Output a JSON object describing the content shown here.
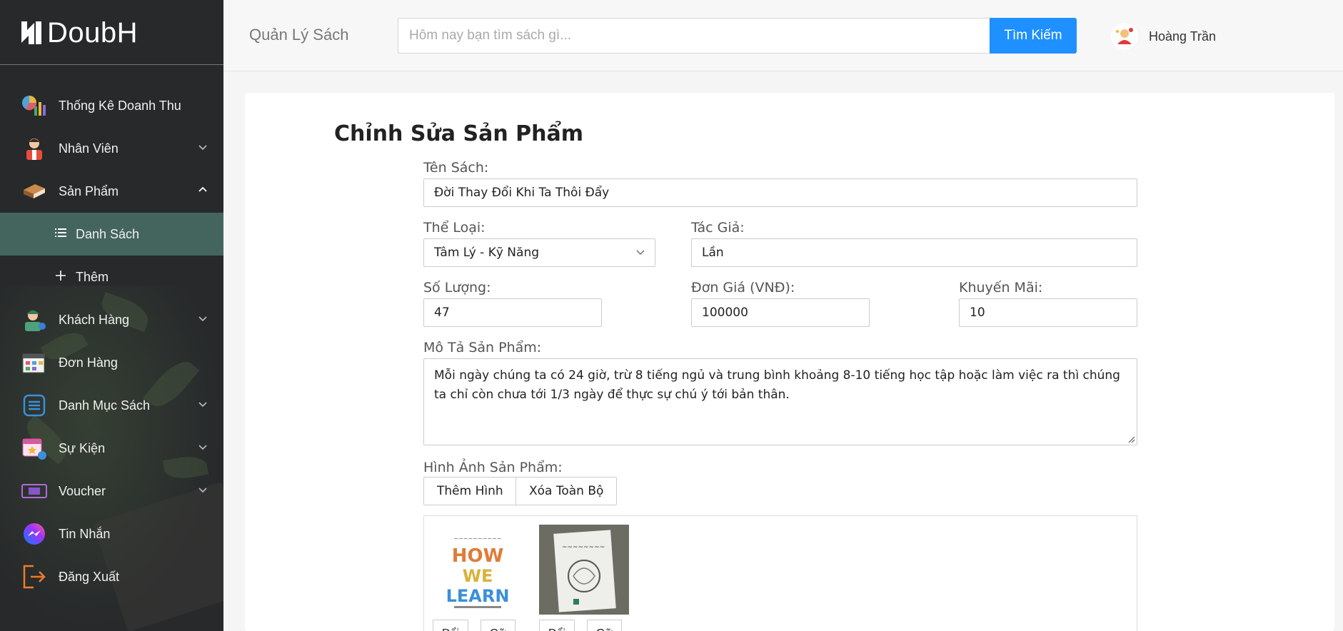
{
  "app": {
    "logo_text": "DoubH",
    "header_title": "Quản Lý Sách"
  },
  "search": {
    "placeholder": "Hôm nay bạn tìm sách gì...",
    "button_label": "Tìm Kiếm"
  },
  "user": {
    "name": "Hoàng Trần"
  },
  "sidebar": {
    "items": [
      {
        "label": "Thống Kê Doanh Thu",
        "icon": "chart-icon"
      },
      {
        "label": "Nhân Viên",
        "icon": "employee-icon"
      },
      {
        "label": "Sản Phẩm",
        "icon": "book-icon"
      },
      {
        "label": "Khách Hàng",
        "icon": "customer-icon"
      },
      {
        "label": "Đơn Hàng",
        "icon": "order-icon"
      },
      {
        "label": "Danh Mục Sách",
        "icon": "catalog-icon"
      },
      {
        "label": "Sự Kiện",
        "icon": "event-icon"
      },
      {
        "label": "Voucher",
        "icon": "voucher-icon"
      },
      {
        "label": "Tin Nhắn",
        "icon": "messenger-icon"
      },
      {
        "label": "Đăng Xuất",
        "icon": "logout-icon"
      }
    ],
    "sub_items": [
      {
        "label": "Danh Sách",
        "icon": "list-icon"
      },
      {
        "label": "Thêm",
        "icon": "plus-icon"
      }
    ]
  },
  "form": {
    "title": "Chỉnh Sửa Sản Phẩm",
    "name_label": "Tên Sách:",
    "name_value": "Đời Thay Đổi Khi Ta Thôi Đẩy",
    "category_label": "Thể Loại:",
    "category_value": "Tâm Lý - Kỹ Năng",
    "author_label": "Tác Giả:",
    "author_value": "Lần",
    "quantity_label": "Số Lượng:",
    "quantity_value": "47",
    "price_label": "Đơn Giá (VNĐ):",
    "price_value": "100000",
    "discount_label": "Khuyến Mãi:",
    "discount_value": "10",
    "description_label": "Mô Tả Sản Phẩm:",
    "description_value": "Mỗi ngày chúng ta có 24 giờ, trừ 8 tiếng ngủ và trung bình khoảng 8-10 tiếng học tập hoặc làm việc ra thì chúng ta chỉ còn chưa tới 1/3 ngày để thực sự chú ý tới bản thân.",
    "images_label": "Hình Ảnh Sản Phẩm:",
    "add_image_label": "Thêm Hình",
    "delete_all_label": "Xóa Toàn Bộ",
    "images": [
      {
        "change_label": "Đổi",
        "remove_label": "Gỡ"
      },
      {
        "change_label": "Đổi",
        "remove_label": "Gỡ"
      }
    ]
  },
  "colors": {
    "sidebar_bg": "#27292b",
    "active_sub_bg": "#44645e",
    "accent": "#1e90ff"
  }
}
